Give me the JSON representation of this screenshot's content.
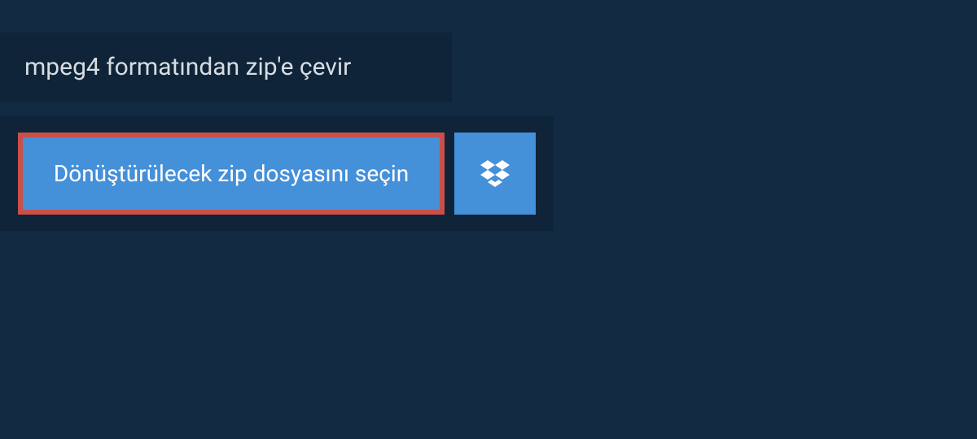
{
  "header": {
    "title": "mpeg4 formatından zip'e çevir"
  },
  "upload": {
    "select_file_label": "Dönüştürülecek zip dosyasını seçin",
    "dropbox_icon": "dropbox-icon"
  }
}
